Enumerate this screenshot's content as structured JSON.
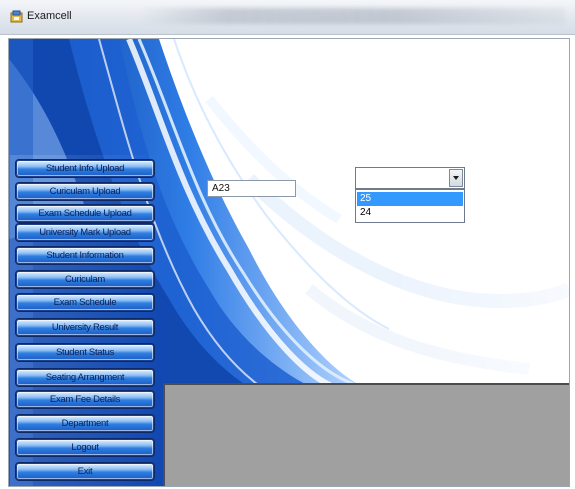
{
  "window": {
    "title": "Examcell"
  },
  "menu": {
    "items": [
      "Student Info Upload",
      "Curiculam Upload",
      "Exam Schedule Upload",
      "University Mark Upload",
      "Student Information",
      "Curiculam",
      "Exam Schedule",
      "University Result",
      "Student Status",
      "Seating Arrangment",
      "Exam Fee Details",
      "Department",
      "Logout",
      "Exit"
    ]
  },
  "form": {
    "text_value": "A23",
    "combo_value": "",
    "dropdown_options": [
      "25",
      "24"
    ],
    "selected_option": "25"
  },
  "colors": {
    "accent": "#1c5cc7",
    "selection": "#3399ff",
    "panel": "#a0a0a0"
  },
  "icons": {
    "app": "examcell-app-icon",
    "combo": "chevron-down-icon"
  }
}
